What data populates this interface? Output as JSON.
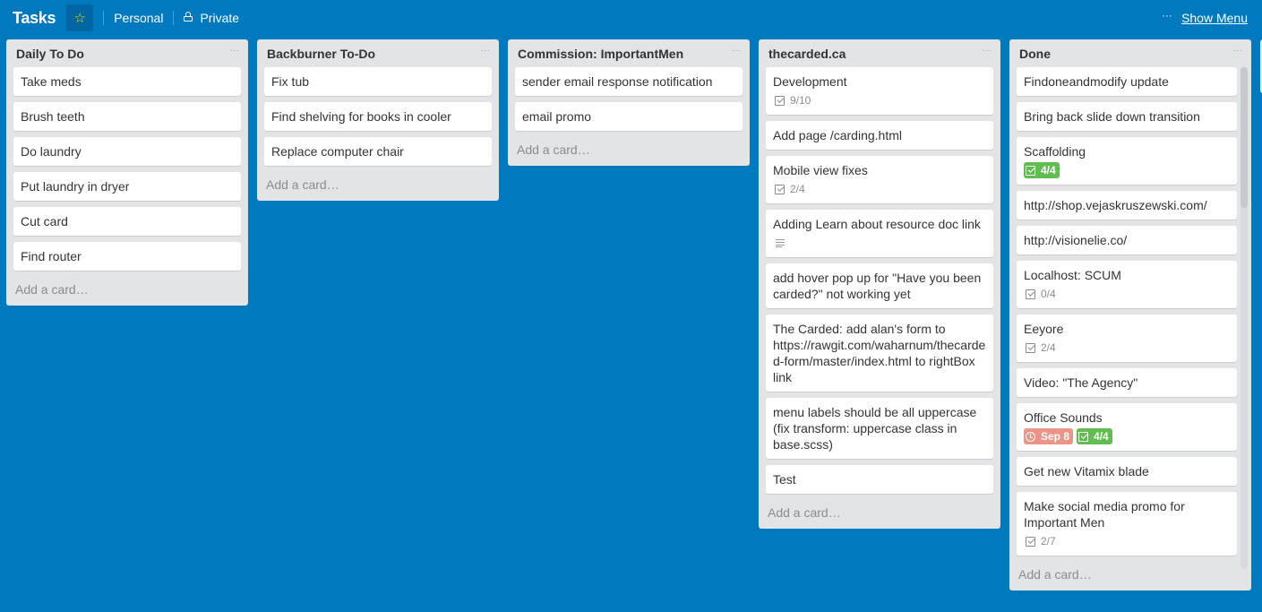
{
  "header": {
    "board_title": "Tasks",
    "star_icon": "star-icon",
    "team_label": "Personal",
    "visibility_label": "Private",
    "visibility_icon": "lock-icon",
    "menu_dots": "···",
    "show_menu_label": "Show Menu"
  },
  "colors": {
    "board_background": "#0079bf",
    "list_background": "#e2e4e6",
    "complete_badge": "#61bd4f",
    "due_badge": "#ec9488",
    "star": "#f2d600"
  },
  "list_menu_glyph": "···",
  "add_card_label": "Add a card…",
  "lists": [
    {
      "title": "Daily To Do",
      "cards": [
        {
          "title": "Take meds"
        },
        {
          "title": "Brush teeth"
        },
        {
          "title": "Do laundry"
        },
        {
          "title": "Put laundry in dryer"
        },
        {
          "title": "Cut card"
        },
        {
          "title": "Find router"
        }
      ]
    },
    {
      "title": "Backburner To-Do",
      "cards": [
        {
          "title": "Fix tub"
        },
        {
          "title": "Find shelving for books in cooler"
        },
        {
          "title": "Replace computer chair"
        }
      ]
    },
    {
      "title": "Commission: ImportantMen",
      "cards": [
        {
          "title": "sender email response notification"
        },
        {
          "title": "email promo"
        }
      ]
    },
    {
      "title": "thecarded.ca",
      "cards": [
        {
          "title": "Development",
          "checklist": "9/10"
        },
        {
          "title": "Add page /carding.html"
        },
        {
          "title": "Mobile view fixes",
          "checklist": "2/4"
        },
        {
          "title": "Adding Learn about resource doc link",
          "has_description": true
        },
        {
          "title": "add hover pop up for \"Have you been carded?\" not working yet"
        },
        {
          "title": "The Carded: add alan's form to https://rawgit.com/waharnum/thecarded-form/master/index.html to rightBox link"
        },
        {
          "title": "menu labels should be all uppercase (fix transform: uppercase class in base.scss)"
        },
        {
          "title": "Test"
        }
      ]
    },
    {
      "title": "Done",
      "cards": [
        {
          "title": "Findoneandmodify update"
        },
        {
          "title": "Bring back slide down transition"
        },
        {
          "title": "Scaffolding",
          "checklist": "4/4",
          "checklist_complete": true
        },
        {
          "title": "http://shop.vejaskruszewski.com/"
        },
        {
          "title": "http://visionelie.co/"
        },
        {
          "title": "Localhost: SCUM",
          "checklist": "0/4"
        },
        {
          "title": "Eeyore",
          "checklist": "2/4"
        },
        {
          "title": "Video: \"The Agency\""
        },
        {
          "title": "Office Sounds",
          "due": "Sep 8",
          "checklist": "4/4",
          "checklist_complete": true
        },
        {
          "title": "Get new Vitamix blade"
        },
        {
          "title": "Make social media promo for Important Men",
          "checklist": "2/7"
        }
      ]
    }
  ]
}
